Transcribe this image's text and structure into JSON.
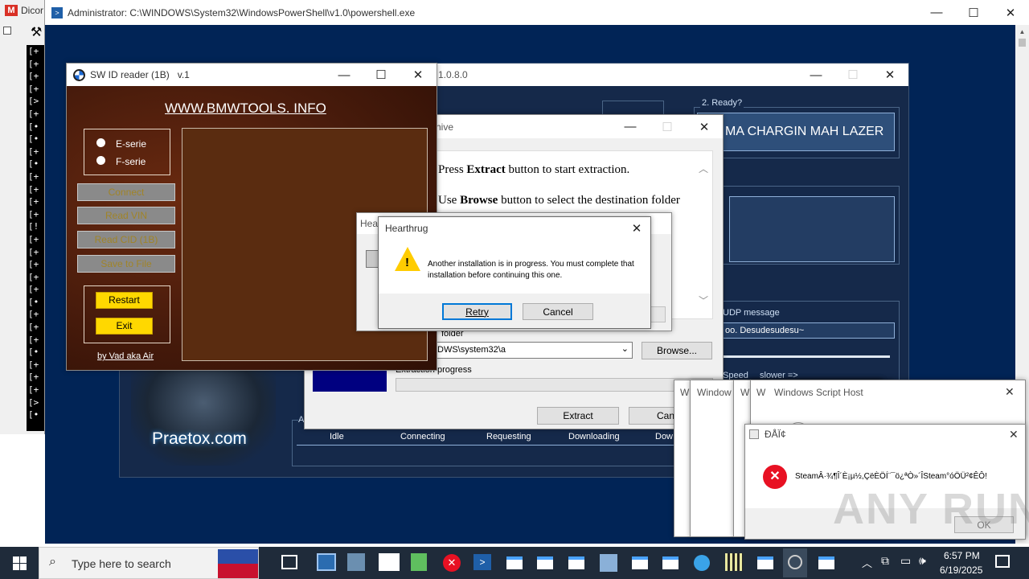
{
  "desktop": {
    "bg_window_title": "Dicor",
    "console_lines": [
      "[+",
      "[+",
      "[+",
      "[+",
      "[>",
      "[+",
      "[•",
      "[•",
      "[+",
      "[•",
      "[+",
      "[+",
      "[+",
      "[+",
      "[!",
      "[+",
      "[+",
      "[+",
      "[+",
      "[+",
      "[•",
      "[+",
      "[+",
      "[+",
      "[•",
      "[+",
      "[+",
      "[+",
      "[>",
      "[•"
    ]
  },
  "powershell": {
    "title": "Administrator: C:\\WINDOWS\\System32\\WindowsPowerShell\\v1.0\\powershell.exe"
  },
  "lazer": {
    "version": "1.0.8.0",
    "ready_label": "2. Ready?",
    "fire_button": "MA CHARGIN MAH LAZER",
    "udp_label": "UDP message",
    "udp_value": "oo. Desudesudesu~",
    "speed_label": "Speed",
    "slower_label": "slower =>",
    "status_a": "A",
    "statuses": [
      "Idle",
      "Connecting",
      "Requesting",
      "Downloading",
      "Dow"
    ],
    "brand": "Praetox.com"
  },
  "swid": {
    "title": "SW ID reader (1B)",
    "version": "v.1",
    "site": "WWW.BMWTOOLS. INFO",
    "radio_e": "E-serie",
    "radio_f": "F-serie",
    "buttons": [
      "Connect",
      "Read VIN",
      "Read CID (1B)",
      "Save to File"
    ],
    "restart": "Restart",
    "exit": "Exit",
    "credit": "by Vad aka Air"
  },
  "archive": {
    "title_fragment": "hive",
    "line1_pre": "Press ",
    "line1_bold": "Extract",
    "line1_post": " button to start extraction.",
    "line2_pre": "Use ",
    "line2_bold": "Browse",
    "line2_post": " button to select the destination folder",
    "folder_label": "folder",
    "folder_value": "DWS\\system32\\a",
    "browse": "Browse...",
    "progress_label": "Extraction progress",
    "extract": "Extract",
    "cancel_fragment": "Canc"
  },
  "hearthrug_back": {
    "title_fragment": "Hea"
  },
  "hearthrug": {
    "title": "Hearthrug",
    "message": "Another installation is in progress. You must complete that installation before continuing this one.",
    "retry": "Retry",
    "cancel": "Cancel"
  },
  "script_host": {
    "frag1": "W",
    "frag2": "Window",
    "frag3": "W",
    "title": "Windows Script Host"
  },
  "steam_error": {
    "title": "ÐÅÏ¢",
    "message": "SteamÂ·¾¶Î´È¡µ½,ÇëÈÖÍ¨¯ö¿ªÒ»´ÎSteam°óÖÜ²¢ÊÔ!",
    "ok": "OK"
  },
  "watermark": "ANY RUN",
  "taskbar": {
    "search_placeholder": "Type here to search",
    "time": "6:57 PM",
    "date": "6/19/2025"
  },
  "colors": {
    "ps_blue": "#012456",
    "lazer_navy": "#15294a",
    "leather": "#4a1c0c",
    "bmw_yellow": "#ffd800",
    "taskbar": "#1f2b3a"
  }
}
